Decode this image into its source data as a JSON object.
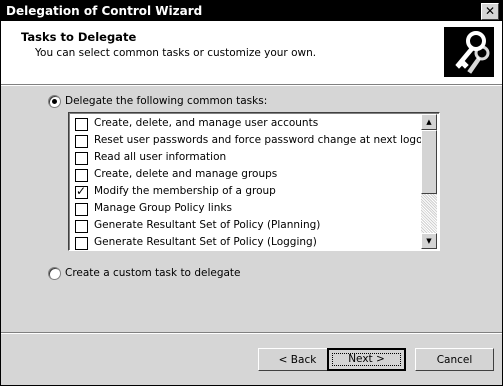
{
  "window": {
    "title": "Delegation of Control Wizard",
    "close_glyph": "✕"
  },
  "header": {
    "title": "Tasks to Delegate",
    "subtitle": "You can select common tasks or customize your own.",
    "icon": "keys-icon"
  },
  "options": {
    "common": {
      "label": "Delegate the following common tasks:",
      "selected": true
    },
    "custom": {
      "label": "Create a custom task to delegate",
      "selected": false
    }
  },
  "tasks": [
    {
      "label": "Create, delete, and manage user accounts",
      "checked": false
    },
    {
      "label": "Reset user passwords and force password change at next logon",
      "checked": false
    },
    {
      "label": "Read all user information",
      "checked": false
    },
    {
      "label": "Create, delete and manage groups",
      "checked": false
    },
    {
      "label": "Modify the membership of a group",
      "checked": true
    },
    {
      "label": "Manage Group Policy links",
      "checked": false
    },
    {
      "label": "Generate Resultant Set of Policy (Planning)",
      "checked": false
    },
    {
      "label": "Generate Resultant Set of Policy (Logging)",
      "checked": false
    }
  ],
  "scrollbar": {
    "up_glyph": "▲",
    "down_glyph": "▼"
  },
  "buttons": {
    "back": "< Back",
    "next": "Next >",
    "cancel": "Cancel"
  }
}
